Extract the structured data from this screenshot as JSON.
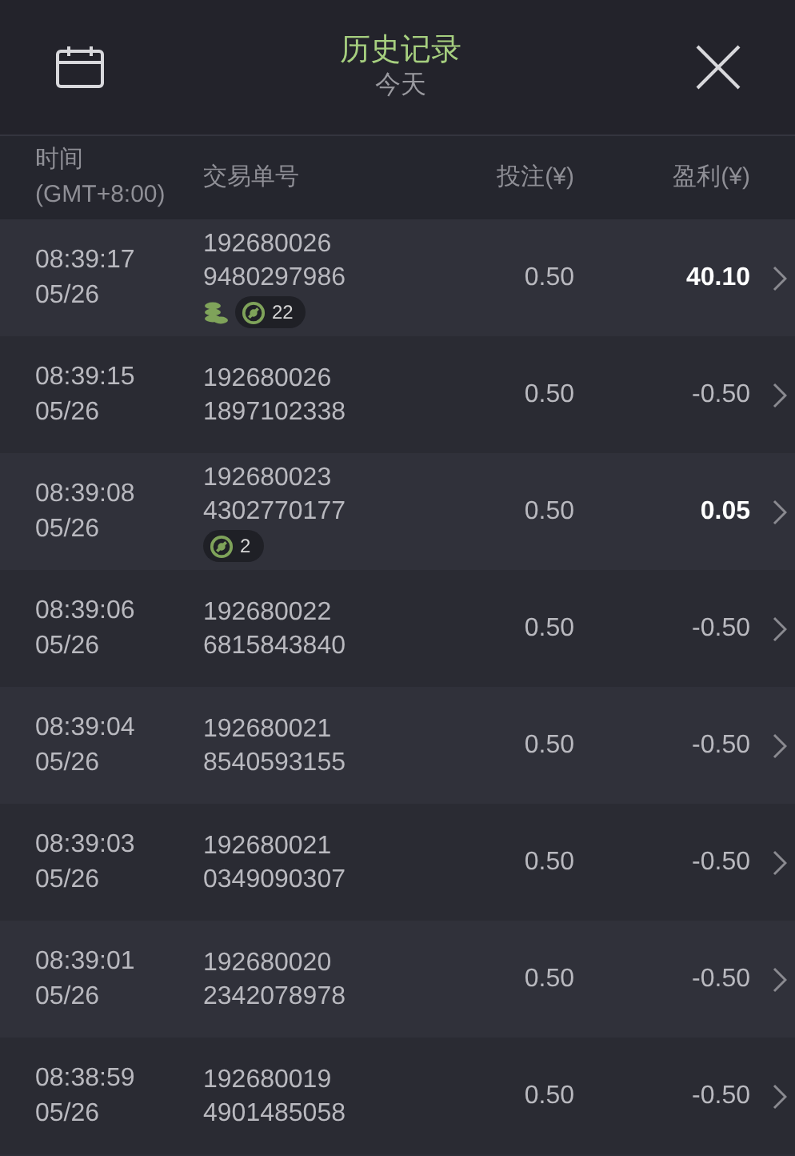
{
  "header": {
    "title": "历史记录",
    "subtitle": "今天"
  },
  "columns": [
    "时间\n(GMT+8:00)",
    "交易单号",
    "投注(¥)",
    "盈利(¥)"
  ],
  "rows": [
    {
      "time": "08:39:17",
      "date": "05/26",
      "id_1": "192680026",
      "id_2": "9480297986",
      "bet": "0.50",
      "profit": "40.10",
      "win": true,
      "badges": [
        {
          "kind": "coins"
        },
        {
          "kind": "spins",
          "count": "22"
        }
      ]
    },
    {
      "time": "08:39:15",
      "date": "05/26",
      "id_1": "192680026",
      "id_2": "1897102338",
      "bet": "0.50",
      "profit": "-0.50",
      "win": false
    },
    {
      "time": "08:39:08",
      "date": "05/26",
      "id_1": "192680023",
      "id_2": "4302770177",
      "bet": "0.50",
      "profit": "0.05",
      "win": true,
      "badges": [
        {
          "kind": "spins",
          "count": "2"
        }
      ]
    },
    {
      "time": "08:39:06",
      "date": "05/26",
      "id_1": "192680022",
      "id_2": "6815843840",
      "bet": "0.50",
      "profit": "-0.50",
      "win": false
    },
    {
      "time": "08:39:04",
      "date": "05/26",
      "id_1": "192680021",
      "id_2": "8540593155",
      "bet": "0.50",
      "profit": "-0.50",
      "win": false
    },
    {
      "time": "08:39:03",
      "date": "05/26",
      "id_1": "192680021",
      "id_2": "0349090307",
      "bet": "0.50",
      "profit": "-0.50",
      "win": false
    },
    {
      "time": "08:39:01",
      "date": "05/26",
      "id_1": "192680020",
      "id_2": "2342078978",
      "bet": "0.50",
      "profit": "-0.50",
      "win": false
    },
    {
      "time": "08:38:59",
      "date": "05/26",
      "id_1": "192680019",
      "id_2": "4901485058",
      "bet": "0.50",
      "profit": "-0.50",
      "win": false
    }
  ]
}
